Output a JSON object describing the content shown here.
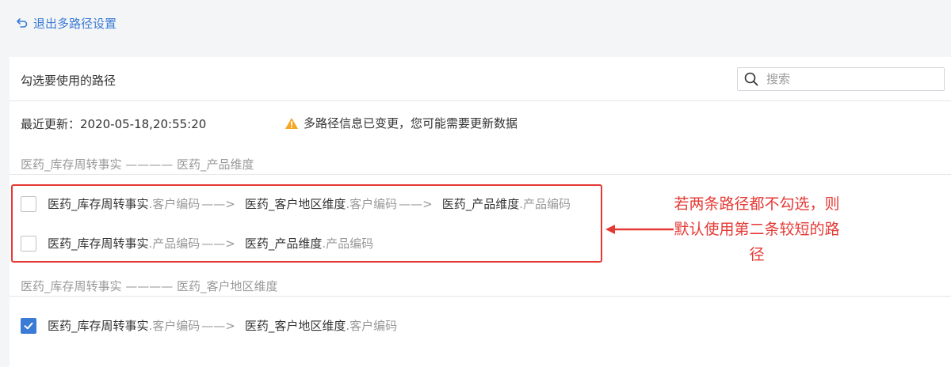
{
  "header": {
    "back_label": "退出多路径设置"
  },
  "panel": {
    "title": "勾选要使用的路径",
    "search_placeholder": "搜索",
    "last_update": "最近更新：2020-05-18,20:55:20",
    "warning": "多路径信息已变更，您可能需要更新数据"
  },
  "groups": [
    {
      "header": "医药_库存周转事实 ———— 医药_产品维度",
      "paths": [
        {
          "checked": false,
          "t1": "医药_库存周转事实",
          "f1": ".客户编码",
          "a1": "——>",
          "t2": "医药_客户地区维度",
          "f2": ".客户编码",
          "a2": "——>",
          "t3": "医药_产品维度",
          "f3": ".产品编码"
        },
        {
          "checked": false,
          "t1": "医药_库存周转事实",
          "f1": ".产品编码",
          "a1": "——>",
          "t2": "医药_产品维度",
          "f2": ".产品编码"
        }
      ]
    },
    {
      "header": "医药_库存周转事实 ———— 医药_客户地区维度",
      "paths": [
        {
          "checked": true,
          "t1": "医药_库存周转事实",
          "f1": ".客户编码",
          "a1": "——>",
          "t2": "医药_客户地区维度",
          "f2": ".客户编码"
        }
      ]
    }
  ],
  "annotation": {
    "text": "若两条路径都不勾选，则默认使用第二条较短的路径",
    "color": "#e53935"
  },
  "colors": {
    "accent": "#3a7bd5",
    "warning": "#f5a623",
    "annotation": "#e53935"
  }
}
